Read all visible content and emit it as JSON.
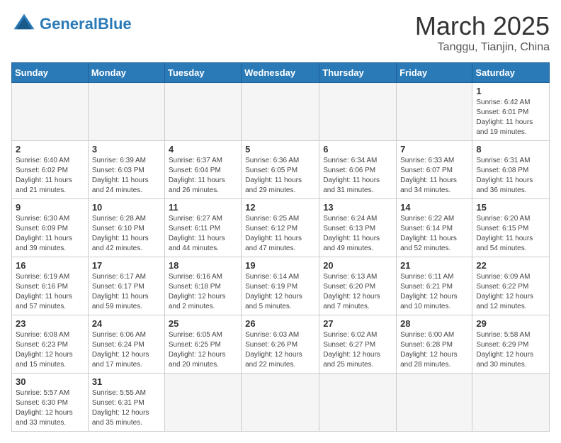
{
  "logo": {
    "text_general": "General",
    "text_blue": "Blue"
  },
  "title": {
    "month": "March 2025",
    "location": "Tanggu, Tianjin, China"
  },
  "weekdays": [
    "Sunday",
    "Monday",
    "Tuesday",
    "Wednesday",
    "Thursday",
    "Friday",
    "Saturday"
  ],
  "weeks": [
    [
      {
        "day": "",
        "info": ""
      },
      {
        "day": "",
        "info": ""
      },
      {
        "day": "",
        "info": ""
      },
      {
        "day": "",
        "info": ""
      },
      {
        "day": "",
        "info": ""
      },
      {
        "day": "",
        "info": ""
      },
      {
        "day": "1",
        "info": "Sunrise: 6:42 AM\nSunset: 6:01 PM\nDaylight: 11 hours and 19 minutes."
      }
    ],
    [
      {
        "day": "2",
        "info": "Sunrise: 6:40 AM\nSunset: 6:02 PM\nDaylight: 11 hours and 21 minutes."
      },
      {
        "day": "3",
        "info": "Sunrise: 6:39 AM\nSunset: 6:03 PM\nDaylight: 11 hours and 24 minutes."
      },
      {
        "day": "4",
        "info": "Sunrise: 6:37 AM\nSunset: 6:04 PM\nDaylight: 11 hours and 26 minutes."
      },
      {
        "day": "5",
        "info": "Sunrise: 6:36 AM\nSunset: 6:05 PM\nDaylight: 11 hours and 29 minutes."
      },
      {
        "day": "6",
        "info": "Sunrise: 6:34 AM\nSunset: 6:06 PM\nDaylight: 11 hours and 31 minutes."
      },
      {
        "day": "7",
        "info": "Sunrise: 6:33 AM\nSunset: 6:07 PM\nDaylight: 11 hours and 34 minutes."
      },
      {
        "day": "8",
        "info": "Sunrise: 6:31 AM\nSunset: 6:08 PM\nDaylight: 11 hours and 36 minutes."
      }
    ],
    [
      {
        "day": "9",
        "info": "Sunrise: 6:30 AM\nSunset: 6:09 PM\nDaylight: 11 hours and 39 minutes."
      },
      {
        "day": "10",
        "info": "Sunrise: 6:28 AM\nSunset: 6:10 PM\nDaylight: 11 hours and 42 minutes."
      },
      {
        "day": "11",
        "info": "Sunrise: 6:27 AM\nSunset: 6:11 PM\nDaylight: 11 hours and 44 minutes."
      },
      {
        "day": "12",
        "info": "Sunrise: 6:25 AM\nSunset: 6:12 PM\nDaylight: 11 hours and 47 minutes."
      },
      {
        "day": "13",
        "info": "Sunrise: 6:24 AM\nSunset: 6:13 PM\nDaylight: 11 hours and 49 minutes."
      },
      {
        "day": "14",
        "info": "Sunrise: 6:22 AM\nSunset: 6:14 PM\nDaylight: 11 hours and 52 minutes."
      },
      {
        "day": "15",
        "info": "Sunrise: 6:20 AM\nSunset: 6:15 PM\nDaylight: 11 hours and 54 minutes."
      }
    ],
    [
      {
        "day": "16",
        "info": "Sunrise: 6:19 AM\nSunset: 6:16 PM\nDaylight: 11 hours and 57 minutes."
      },
      {
        "day": "17",
        "info": "Sunrise: 6:17 AM\nSunset: 6:17 PM\nDaylight: 11 hours and 59 minutes."
      },
      {
        "day": "18",
        "info": "Sunrise: 6:16 AM\nSunset: 6:18 PM\nDaylight: 12 hours and 2 minutes."
      },
      {
        "day": "19",
        "info": "Sunrise: 6:14 AM\nSunset: 6:19 PM\nDaylight: 12 hours and 5 minutes."
      },
      {
        "day": "20",
        "info": "Sunrise: 6:13 AM\nSunset: 6:20 PM\nDaylight: 12 hours and 7 minutes."
      },
      {
        "day": "21",
        "info": "Sunrise: 6:11 AM\nSunset: 6:21 PM\nDaylight: 12 hours and 10 minutes."
      },
      {
        "day": "22",
        "info": "Sunrise: 6:09 AM\nSunset: 6:22 PM\nDaylight: 12 hours and 12 minutes."
      }
    ],
    [
      {
        "day": "23",
        "info": "Sunrise: 6:08 AM\nSunset: 6:23 PM\nDaylight: 12 hours and 15 minutes."
      },
      {
        "day": "24",
        "info": "Sunrise: 6:06 AM\nSunset: 6:24 PM\nDaylight: 12 hours and 17 minutes."
      },
      {
        "day": "25",
        "info": "Sunrise: 6:05 AM\nSunset: 6:25 PM\nDaylight: 12 hours and 20 minutes."
      },
      {
        "day": "26",
        "info": "Sunrise: 6:03 AM\nSunset: 6:26 PM\nDaylight: 12 hours and 22 minutes."
      },
      {
        "day": "27",
        "info": "Sunrise: 6:02 AM\nSunset: 6:27 PM\nDaylight: 12 hours and 25 minutes."
      },
      {
        "day": "28",
        "info": "Sunrise: 6:00 AM\nSunset: 6:28 PM\nDaylight: 12 hours and 28 minutes."
      },
      {
        "day": "29",
        "info": "Sunrise: 5:58 AM\nSunset: 6:29 PM\nDaylight: 12 hours and 30 minutes."
      }
    ],
    [
      {
        "day": "30",
        "info": "Sunrise: 5:57 AM\nSunset: 6:30 PM\nDaylight: 12 hours and 33 minutes."
      },
      {
        "day": "31",
        "info": "Sunrise: 5:55 AM\nSunset: 6:31 PM\nDaylight: 12 hours and 35 minutes."
      },
      {
        "day": "",
        "info": ""
      },
      {
        "day": "",
        "info": ""
      },
      {
        "day": "",
        "info": ""
      },
      {
        "day": "",
        "info": ""
      },
      {
        "day": "",
        "info": ""
      }
    ]
  ]
}
